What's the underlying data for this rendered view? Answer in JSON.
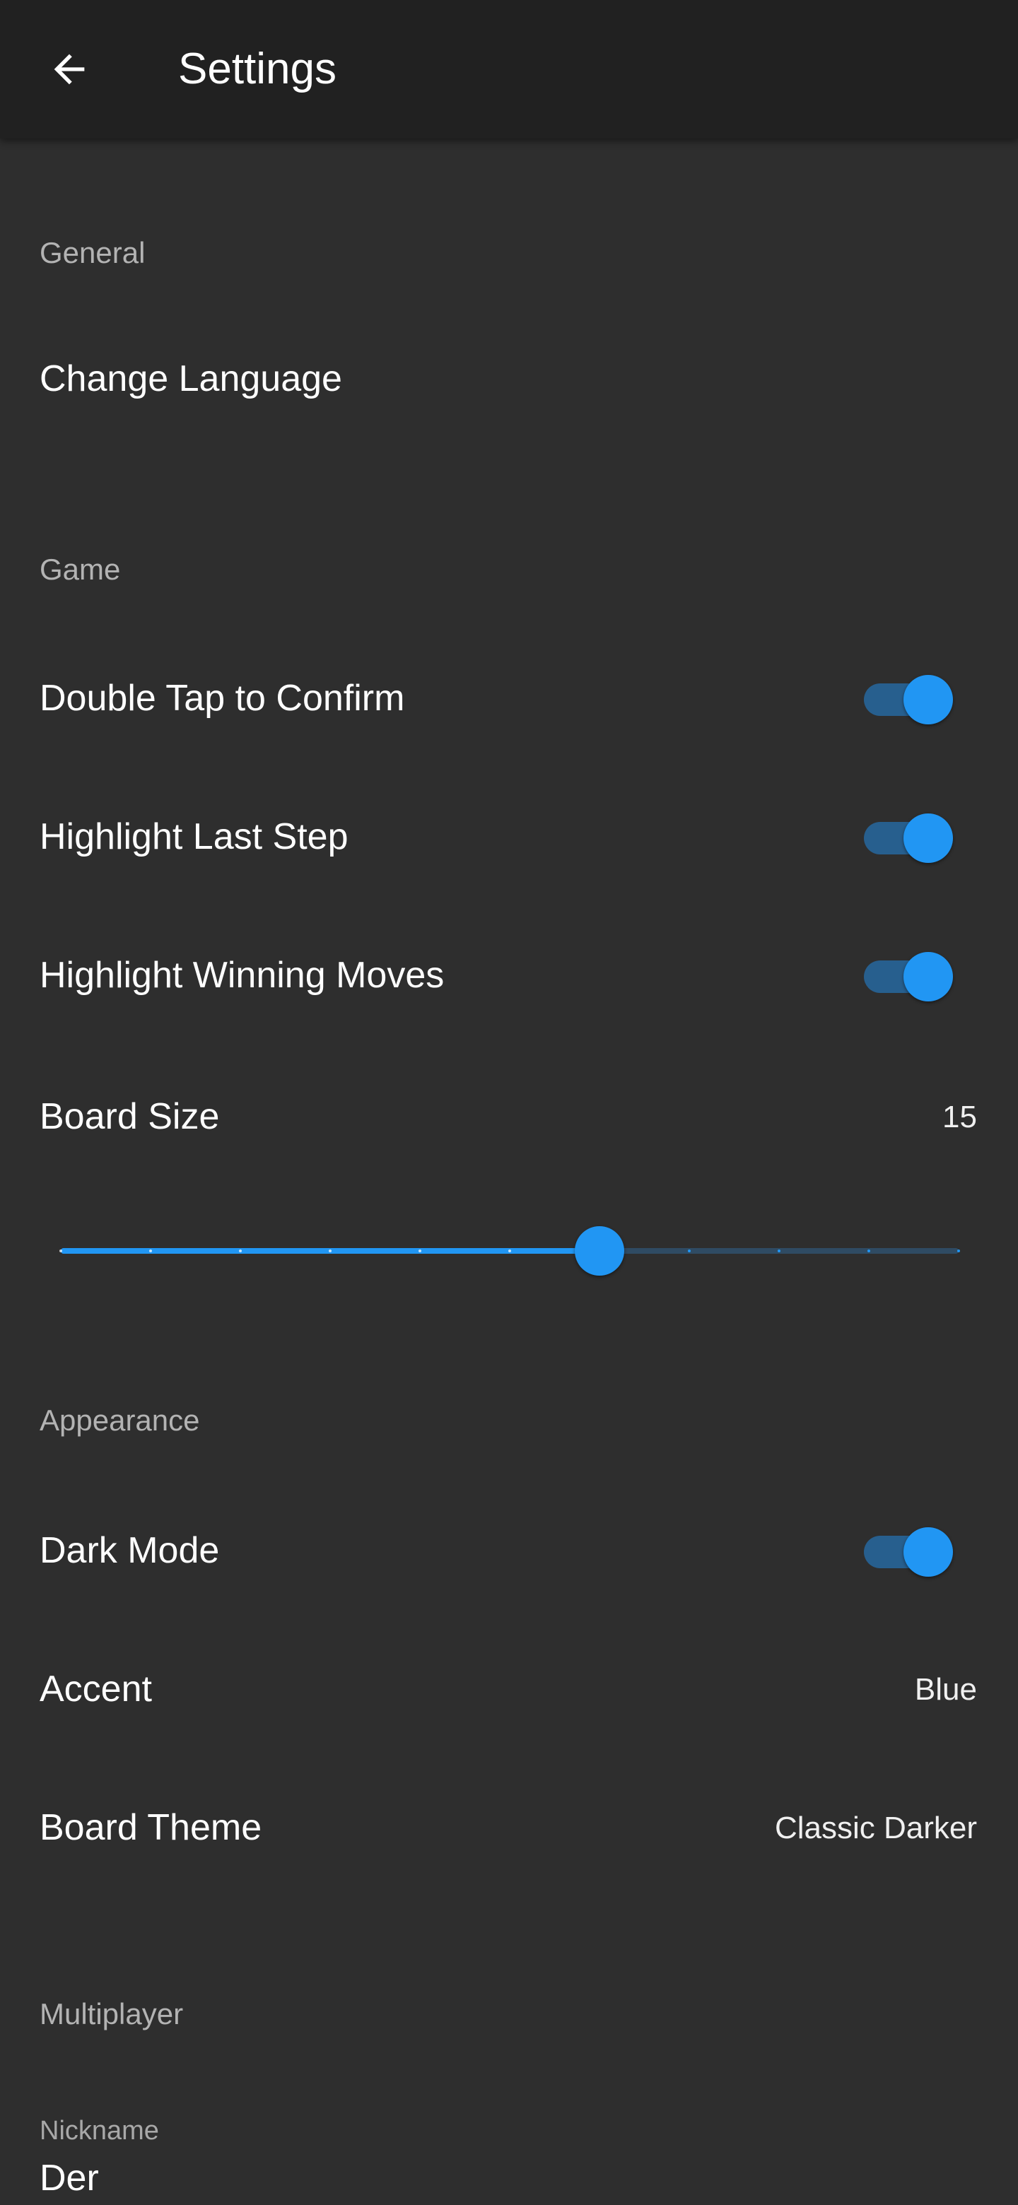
{
  "appbar": {
    "back_icon": "arrow-left-icon",
    "title": "Settings"
  },
  "general": {
    "header": "General",
    "change_language": "Change Language"
  },
  "game": {
    "header": "Game",
    "double_tap": {
      "label": "Double Tap to Confirm",
      "on": true
    },
    "highlight_last": {
      "label": "Highlight Last Step",
      "on": true
    },
    "highlight_winning": {
      "label": "Highlight Winning Moves",
      "on": true
    },
    "board_size": {
      "label": "Board Size",
      "value": "15",
      "min": 9,
      "max": 19,
      "step": 1,
      "current": 15
    }
  },
  "appearance": {
    "header": "Appearance",
    "dark_mode": {
      "label": "Dark Mode",
      "on": true
    },
    "accent": {
      "label": "Accent",
      "value": "Blue"
    },
    "board_theme": {
      "label": "Board Theme",
      "value": "Classic Darker"
    }
  },
  "multiplayer": {
    "header": "Multiplayer",
    "nickname_label": "Nickname",
    "nickname_value": "Der"
  },
  "colors": {
    "accent": "#2196f3",
    "background": "#2e2e2e",
    "appbar": "#212121"
  }
}
